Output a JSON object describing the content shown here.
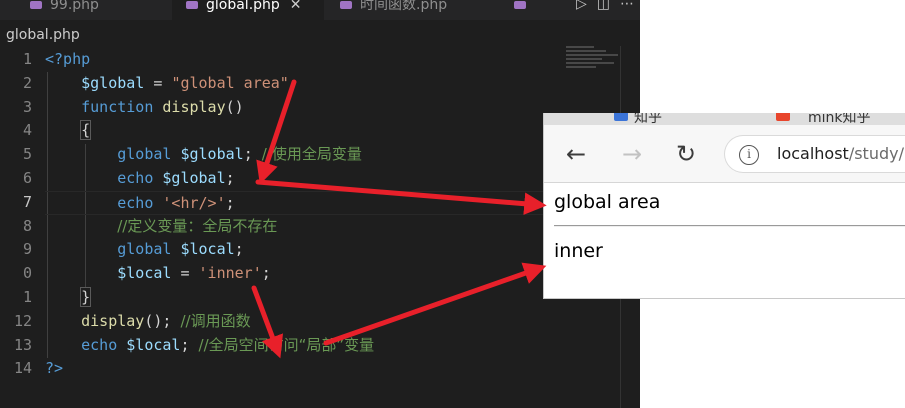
{
  "tabs": [
    {
      "label": "99.php"
    },
    {
      "label": "global.php",
      "close": "✕"
    },
    {
      "label": "时间函数.php"
    }
  ],
  "breadcrumb": "global.php",
  "line_numbers": [
    "1",
    "2",
    "3",
    "4",
    "5",
    "6",
    "7",
    "8",
    "9",
    "0",
    "1",
    "12",
    "13",
    "14"
  ],
  "code": {
    "l1": "<?php",
    "l2_var": "$global",
    "l2_eq": " = ",
    "l2_str": "\"global area\"",
    "l2_end": ";",
    "l3_kw": "function",
    "l3_fn": "display",
    "l3_end": "()",
    "l4": "{",
    "l5_kw": "global",
    "l5_var": "$global",
    "l5_end": "; ",
    "l5_cmt": "//使用全局变量",
    "l6_kw": "echo",
    "l6_var": "$global",
    "l6_end": ";",
    "l7_kw": "echo",
    "l7_str": "'<hr/>'",
    "l7_end": ";",
    "l8_cmt": "//定义变量：全局不存在",
    "l9_kw": "global",
    "l9_var": "$local",
    "l9_end": ";",
    "l10_var": "$local",
    "l10_eq": " = ",
    "l10_str": "'inner'",
    "l10_end": ";",
    "l11": "}",
    "l12_fn": "display",
    "l12_end": "(); ",
    "l12_cmt": "//调用函数",
    "l13_kw": "echo",
    "l13_var": "$local",
    "l13_end": "; ",
    "l13_cmt": "//全局空间访问“局部”变量",
    "l14": "?>"
  },
  "browser": {
    "tab_title": "知乎",
    "tab2_title": "mink知乎",
    "back": "←",
    "forward": "→",
    "reload": "↻",
    "info": "i",
    "url_host": "localhost",
    "url_path": "/study/",
    "output_line1": "global area",
    "output_line2": "inner"
  },
  "colors": {
    "arrow": "#e8202a",
    "keyword": "#569cd6",
    "variable": "#9cdcfe",
    "function": "#dcdcaa",
    "string": "#ce9178",
    "comment": "#6a9955"
  }
}
